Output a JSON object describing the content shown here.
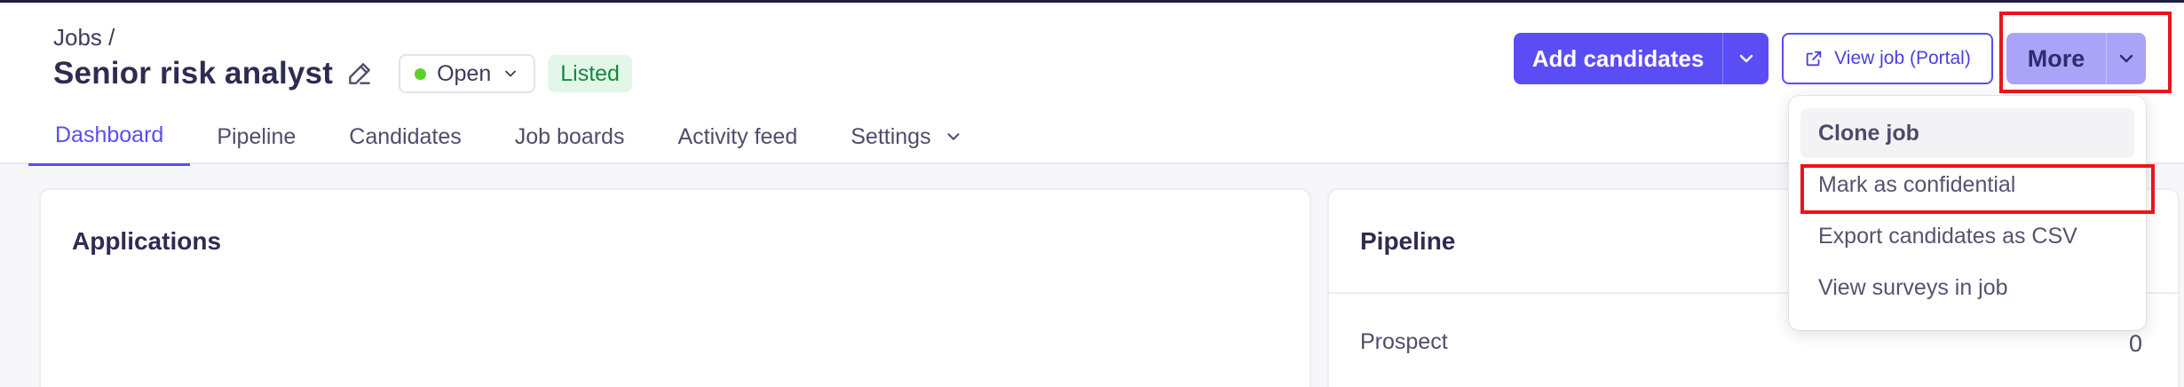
{
  "breadcrumb": "Jobs /",
  "job": {
    "title": "Senior risk analyst",
    "status": "Open",
    "status_color": "#5fcf2d",
    "listed_label": "Listed"
  },
  "actions": {
    "add_candidates": "Add candidates",
    "view_job_portal": "View job (Portal)",
    "more": "More"
  },
  "tabs": [
    {
      "label": "Dashboard",
      "active": true
    },
    {
      "label": "Pipeline"
    },
    {
      "label": "Candidates"
    },
    {
      "label": "Job boards"
    },
    {
      "label": "Activity feed"
    },
    {
      "label": "Settings"
    }
  ],
  "cards": {
    "applications_title": "Applications",
    "pipeline_title": "Pipeline",
    "pipeline_rows": [
      {
        "label": "Prospect",
        "count": "0"
      }
    ]
  },
  "more_menu": {
    "items": [
      {
        "label": "Clone job",
        "hovered": true
      },
      {
        "label": "Mark as confidential",
        "highlighted": true
      },
      {
        "label": "Export candidates as CSV"
      },
      {
        "label": "View surveys in job"
      }
    ]
  },
  "colors": {
    "accent": "#5b4df5",
    "highlight_box": "#e8151b"
  },
  "icons": {
    "edit": "pencil-icon",
    "external_link": "external-link-icon",
    "caret": "chevron-down-icon"
  }
}
